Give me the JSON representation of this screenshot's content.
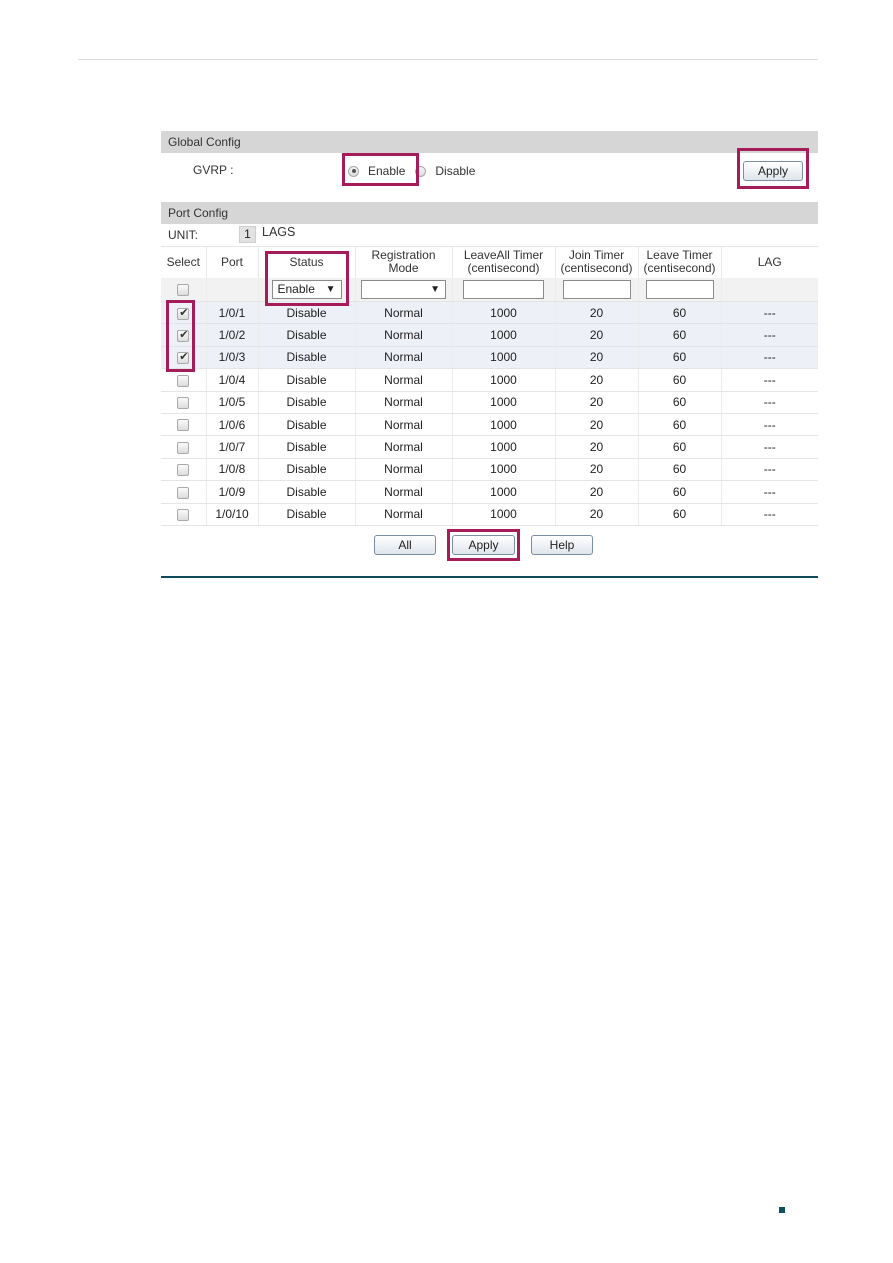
{
  "global_config": {
    "title": "Global Config",
    "gvrp_label": "GVRP :",
    "options": [
      {
        "label": "Enable",
        "checked": true
      },
      {
        "label": "Disable",
        "checked": false
      }
    ],
    "apply_label": "Apply"
  },
  "port_config": {
    "title": "Port Config",
    "unit_label": "UNIT:",
    "unit_value": "1",
    "lags_label": "LAGS",
    "columns": {
      "select": "Select",
      "port": "Port",
      "status": "Status",
      "registration_mode": "Registration Mode",
      "leaveall_timer": "LeaveAll Timer (centisecond)",
      "join_timer": "Join Timer (centisecond)",
      "leave_timer": "Leave Timer (centisecond)",
      "lag": "LAG"
    },
    "filter": {
      "status_value": "Enable",
      "registration_mode_value": "",
      "leaveall_value": "",
      "join_value": "",
      "leave_value": ""
    },
    "rows": [
      {
        "selected": true,
        "port": "1/0/1",
        "status": "Disable",
        "mode": "Normal",
        "leaveall": "1000",
        "join": "20",
        "leave": "60",
        "lag": "---"
      },
      {
        "selected": true,
        "port": "1/0/2",
        "status": "Disable",
        "mode": "Normal",
        "leaveall": "1000",
        "join": "20",
        "leave": "60",
        "lag": "---"
      },
      {
        "selected": true,
        "port": "1/0/3",
        "status": "Disable",
        "mode": "Normal",
        "leaveall": "1000",
        "join": "20",
        "leave": "60",
        "lag": "---"
      },
      {
        "selected": false,
        "port": "1/0/4",
        "status": "Disable",
        "mode": "Normal",
        "leaveall": "1000",
        "join": "20",
        "leave": "60",
        "lag": "---"
      },
      {
        "selected": false,
        "port": "1/0/5",
        "status": "Disable",
        "mode": "Normal",
        "leaveall": "1000",
        "join": "20",
        "leave": "60",
        "lag": "---"
      },
      {
        "selected": false,
        "port": "1/0/6",
        "status": "Disable",
        "mode": "Normal",
        "leaveall": "1000",
        "join": "20",
        "leave": "60",
        "lag": "---"
      },
      {
        "selected": false,
        "port": "1/0/7",
        "status": "Disable",
        "mode": "Normal",
        "leaveall": "1000",
        "join": "20",
        "leave": "60",
        "lag": "---"
      },
      {
        "selected": false,
        "port": "1/0/8",
        "status": "Disable",
        "mode": "Normal",
        "leaveall": "1000",
        "join": "20",
        "leave": "60",
        "lag": "---"
      },
      {
        "selected": false,
        "port": "1/0/9",
        "status": "Disable",
        "mode": "Normal",
        "leaveall": "1000",
        "join": "20",
        "leave": "60",
        "lag": "---"
      },
      {
        "selected": false,
        "port": "1/0/10",
        "status": "Disable",
        "mode": "Normal",
        "leaveall": "1000",
        "join": "20",
        "leave": "60",
        "lag": "---"
      }
    ],
    "buttons": {
      "all": "All",
      "apply": "Apply",
      "help": "Help"
    }
  },
  "colors": {
    "highlight": "#a61c5b",
    "section_header": "#d6d6d6",
    "rule": "#0e4a5a"
  }
}
